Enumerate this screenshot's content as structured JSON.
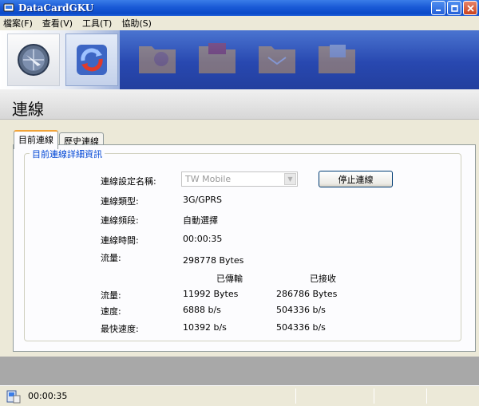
{
  "window": {
    "title": "DataCardGKU"
  },
  "menu": {
    "items": [
      "檔案(F)",
      "查看(V)",
      "工具(T)",
      "協助(S)"
    ]
  },
  "page": {
    "title": "連線"
  },
  "tabs": [
    "目前連線",
    "歷史連線"
  ],
  "group": {
    "label": "目前連線詳細資訊"
  },
  "details": {
    "profile_label": "連線設定名稱:",
    "profile_value": "TW Mobile",
    "stop_button": "停止連線",
    "type_label": "連線類型:",
    "type_value": "3G/GPRS",
    "band_label": "連線頻段:",
    "band_value": "自動選擇",
    "time_label": "連線時間:",
    "time_value": "00:00:35",
    "traffic_label": "流量:",
    "traffic_value": "298778 Bytes",
    "sent_header": "已傳輸",
    "recv_header": "已接收",
    "flow_label": "流量:",
    "flow_sent": "11992 Bytes",
    "flow_recv": "286786 Bytes",
    "speed_label": "速度:",
    "speed_sent": "6888 b/s",
    "speed_recv": "504336 b/s",
    "max_label": "最快速度:",
    "max_sent": "10392 b/s",
    "max_recv": "504336 b/s"
  },
  "status": {
    "time": "00:00:35"
  },
  "colors": {
    "accent": "#0046d5",
    "titlebar": "#0a49c8",
    "tab_highlight": "#f1a43a"
  }
}
